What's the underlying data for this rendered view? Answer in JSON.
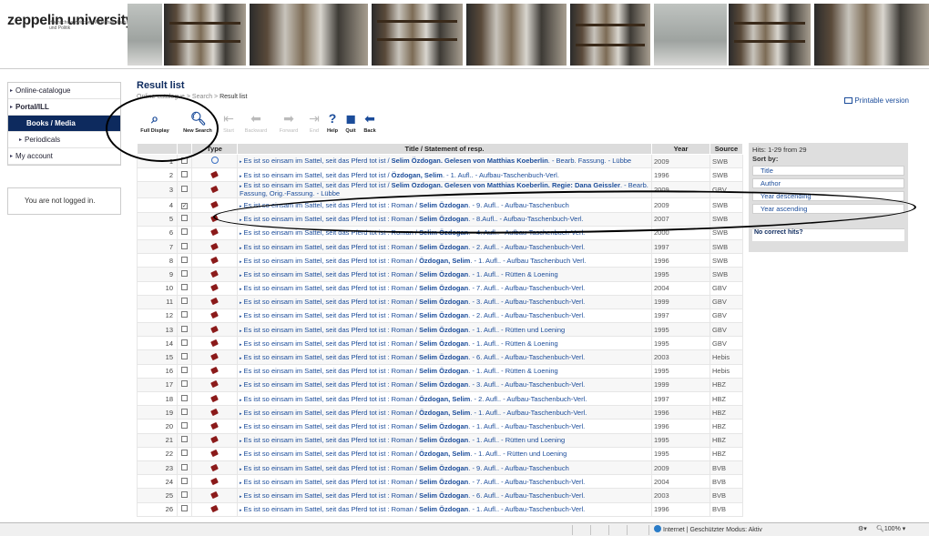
{
  "header": {
    "logo_name": "zeppelin university",
    "logo_sub": "Hochschule zwischen Wirtschaft, Kultur und Politik"
  },
  "sidebar": {
    "items": [
      {
        "label": "Online-catalogue"
      },
      {
        "label": "Portal/ILL"
      },
      {
        "label": "Books / Media"
      },
      {
        "label": "Periodicals"
      },
      {
        "label": "My account"
      }
    ],
    "login_status": "You are not logged in."
  },
  "main": {
    "title": "Result list",
    "breadcrumb": {
      "part1": "Online-catalogue",
      "part2": "Search",
      "current": "Result list"
    },
    "printable": "Printable version"
  },
  "toolbar": {
    "full_display": "Full Display",
    "new_search": "New Search",
    "start": "Start",
    "backward": "Backward",
    "forward": "Forward",
    "end": "End",
    "help": "Help",
    "quit": "Quit",
    "back": "Back"
  },
  "table": {
    "headers": {
      "type": "Type",
      "title": "Title / Statement of resp.",
      "year": "Year",
      "source": "Source"
    },
    "rows": [
      {
        "num": "1",
        "checked": false,
        "type": "online",
        "t1": "Es ist so einsam im Sattel, seit das Pferd tot ist / ",
        "t2": "Selim Özdogan. Gelesen von Matthias Koeberlin",
        "t3": ". - Bearb. Fassung. - Lübbe",
        "year": "2009",
        "source": "SWB"
      },
      {
        "num": "2",
        "checked": false,
        "type": "book",
        "t1": "Es ist so einsam im Sattel, seit das Pferd tot ist / ",
        "t2": "Özdogan, Selim",
        "t3": ". - 1. Aufl.. - Aufbau-Taschenbuch-Verl.",
        "year": "1996",
        "source": "SWB"
      },
      {
        "num": "3",
        "checked": false,
        "type": "book",
        "t1": "Es ist so einsam im Sattel, seit das Pferd tot ist / ",
        "t2": "Selim Özdogan. Gelesen von Matthias Koeberlin. Regie: Dana Geissler",
        "t3": ". - Bearb. Fassung, Orig.-Fassung. - Lübbe",
        "year": "2009",
        "source": "GBV"
      },
      {
        "num": "4",
        "checked": true,
        "type": "book",
        "t1": "Es ist so einsam im Sattel, seit das Pferd tot ist : Roman / ",
        "t2": "Selim Özdogan",
        "t3": ". - 9. Aufl.. - Aufbau-Taschenbuch",
        "year": "2009",
        "source": "SWB"
      },
      {
        "num": "5",
        "checked": false,
        "type": "book",
        "t1": "Es ist so einsam im Sattel, seit das Pferd tot ist : Roman / ",
        "t2": "Selim Özdogan",
        "t3": ". - 8.Aufl.. - Aufbau-Taschenbuch-Verl.",
        "year": "2007",
        "source": "SWB"
      },
      {
        "num": "6",
        "checked": false,
        "type": "book",
        "t1": "Es ist so einsam im Sattel, seit das Pferd tot ist : Roman / ",
        "t2": "Selim Özdogan",
        "t3": ". - 4. Aufl.. - Aufbau-Taschenbuch-Verl.",
        "year": "2000",
        "source": "SWB"
      },
      {
        "num": "7",
        "checked": false,
        "type": "book",
        "t1": "Es ist so einsam im Sattel, seit das Pferd tot ist : Roman / ",
        "t2": "Selim Özdogan",
        "t3": ". - 2. Aufl.. - Aufbau-Taschenbuch-Verl.",
        "year": "1997",
        "source": "SWB"
      },
      {
        "num": "8",
        "checked": false,
        "type": "book",
        "t1": "Es ist so einsam im Sattel, seit das Pferd tot ist : Roman / ",
        "t2": "Özdogan, Selim",
        "t3": ". - 1. Aufl.. - Aufbau Taschenbuch Verl.",
        "year": "1996",
        "source": "SWB"
      },
      {
        "num": "9",
        "checked": false,
        "type": "book",
        "t1": "Es ist so einsam im Sattel, seit das Pferd tot ist : Roman / ",
        "t2": "Selim Özdogan",
        "t3": ". - 1. Aufl.. - Rütten & Loening",
        "year": "1995",
        "source": "SWB"
      },
      {
        "num": "10",
        "checked": false,
        "type": "book",
        "t1": "Es ist so einsam im Sattel, seit das Pferd tot ist : Roman / ",
        "t2": "Selim Özdogan",
        "t3": ". - 7. Aufl.. - Aufbau-Taschenbuch-Verl.",
        "year": "2004",
        "source": "GBV"
      },
      {
        "num": "11",
        "checked": false,
        "type": "book",
        "t1": "Es ist so einsam im Sattel, seit das Pferd tot ist : Roman / ",
        "t2": "Selim Özdogan",
        "t3": ". - 3. Aufl.. - Aufbau-Taschenbuch-Verl.",
        "year": "1999",
        "source": "GBV"
      },
      {
        "num": "12",
        "checked": false,
        "type": "book",
        "t1": "Es ist so einsam im Sattel, seit das Pferd tot ist : Roman / ",
        "t2": "Selim Özdogan",
        "t3": ". - 2. Aufl.. - Aufbau-Taschenbuch-Verl.",
        "year": "1997",
        "source": "GBV"
      },
      {
        "num": "13",
        "checked": false,
        "type": "book",
        "t1": "Es ist so einsam im Sattel, seit das Pferd tot ist : Roman / ",
        "t2": "Selim Özdogan",
        "t3": ". - 1. Aufl.. - Rütten und Loening",
        "year": "1995",
        "source": "GBV"
      },
      {
        "num": "14",
        "checked": false,
        "type": "book",
        "t1": "Es ist so einsam im Sattel, seit das Pferd tot ist : Roman / ",
        "t2": "Selim Özdogan",
        "t3": ". - 1. Aufl.. - Rütten & Loening",
        "year": "1995",
        "source": "GBV"
      },
      {
        "num": "15",
        "checked": false,
        "type": "book",
        "t1": "Es ist so einsam im Sattel, seit das Pferd tot ist : Roman / ",
        "t2": "Selim Özdogan",
        "t3": ". - 6. Aufl.. - Aufbau-Taschenbuch-Verl.",
        "year": "2003",
        "source": "Hebis"
      },
      {
        "num": "16",
        "checked": false,
        "type": "book",
        "t1": "Es ist so einsam im Sattel, seit das Pferd tot ist : Roman / ",
        "t2": "Selim Özdogan",
        "t3": ". - 1. Aufl.. - Rütten & Loening",
        "year": "1995",
        "source": "Hebis"
      },
      {
        "num": "17",
        "checked": false,
        "type": "book",
        "t1": "Es ist so einsam im Sattel, seit das Pferd tot ist : Roman / ",
        "t2": "Selim Özdogan",
        "t3": ". - 3. Aufl.. - Aufbau-Taschenbuch-Verl.",
        "year": "1999",
        "source": "HBZ"
      },
      {
        "num": "18",
        "checked": false,
        "type": "book",
        "t1": "Es ist so einsam im Sattel, seit das Pferd tot ist : Roman / ",
        "t2": "Özdogan, Selim",
        "t3": ". - 2. Aufl.. - Aufbau-Taschenbuch-Verl.",
        "year": "1997",
        "source": "HBZ"
      },
      {
        "num": "19",
        "checked": false,
        "type": "book",
        "t1": "Es ist so einsam im Sattel, seit das Pferd tot ist : Roman / ",
        "t2": "Özdogan, Selim",
        "t3": ". - 1. Aufl.. - Aufbau-Taschenbuch-Verl.",
        "year": "1996",
        "source": "HBZ"
      },
      {
        "num": "20",
        "checked": false,
        "type": "book",
        "t1": "Es ist so einsam im Sattel, seit das Pferd tot ist : Roman / ",
        "t2": "Selim Özdogan",
        "t3": ". - 1. Aufl.. - Aufbau-Taschenbuch-Verl.",
        "year": "1996",
        "source": "HBZ"
      },
      {
        "num": "21",
        "checked": false,
        "type": "book",
        "t1": "Es ist so einsam im Sattel, seit das Pferd tot ist : Roman / ",
        "t2": "Selim Özdogan",
        "t3": ". - 1. Aufl.. - Rütten und Loening",
        "year": "1995",
        "source": "HBZ"
      },
      {
        "num": "22",
        "checked": false,
        "type": "book",
        "t1": "Es ist so einsam im Sattel, seit das Pferd tot ist : Roman / ",
        "t2": "Özdogan, Selim",
        "t3": ". - 1. Aufl.. - Rütten und Loening",
        "year": "1995",
        "source": "HBZ"
      },
      {
        "num": "23",
        "checked": false,
        "type": "book",
        "t1": "Es ist so einsam im Sattel, seit das Pferd tot ist : Roman / ",
        "t2": "Selim Özdogan",
        "t3": ". - 9. Aufl.. - Aufbau-Taschenbuch",
        "year": "2009",
        "source": "BVB"
      },
      {
        "num": "24",
        "checked": false,
        "type": "book",
        "t1": "Es ist so einsam im Sattel, seit das Pferd tot ist : Roman / ",
        "t2": "Selim Özdogan",
        "t3": ". - 7. Aufl.. - Aufbau-Taschenbuch-Verl.",
        "year": "2004",
        "source": "BVB"
      },
      {
        "num": "25",
        "checked": false,
        "type": "book",
        "t1": "Es ist so einsam im Sattel, seit das Pferd tot ist : Roman / ",
        "t2": "Selim Özdogan",
        "t3": ". - 6. Aufl.. - Aufbau-Taschenbuch-Verl.",
        "year": "2003",
        "source": "BVB"
      },
      {
        "num": "26",
        "checked": false,
        "type": "book",
        "t1": "Es ist so einsam im Sattel, seit das Pferd tot ist : Roman / ",
        "t2": "Selim Özdogan",
        "t3": ". - 1. Aufl.. - Aufbau-Taschenbuch-Verl.",
        "year": "1996",
        "source": "BVB"
      }
    ]
  },
  "sort": {
    "hits": "Hits: 1-29 from 29",
    "sort_by": "Sort by:",
    "options": [
      "Title",
      "Author",
      "Year descending",
      "Year ascending"
    ],
    "no_correct": "No correct hits?"
  },
  "statusbar": {
    "zone": "Internet | Geschützter Modus: Aktiv",
    "zoom": "100%"
  },
  "colors": {
    "nav_active": "#0d2a5e",
    "link": "#1b4c9a",
    "book_icon": "#8b1a1a"
  }
}
